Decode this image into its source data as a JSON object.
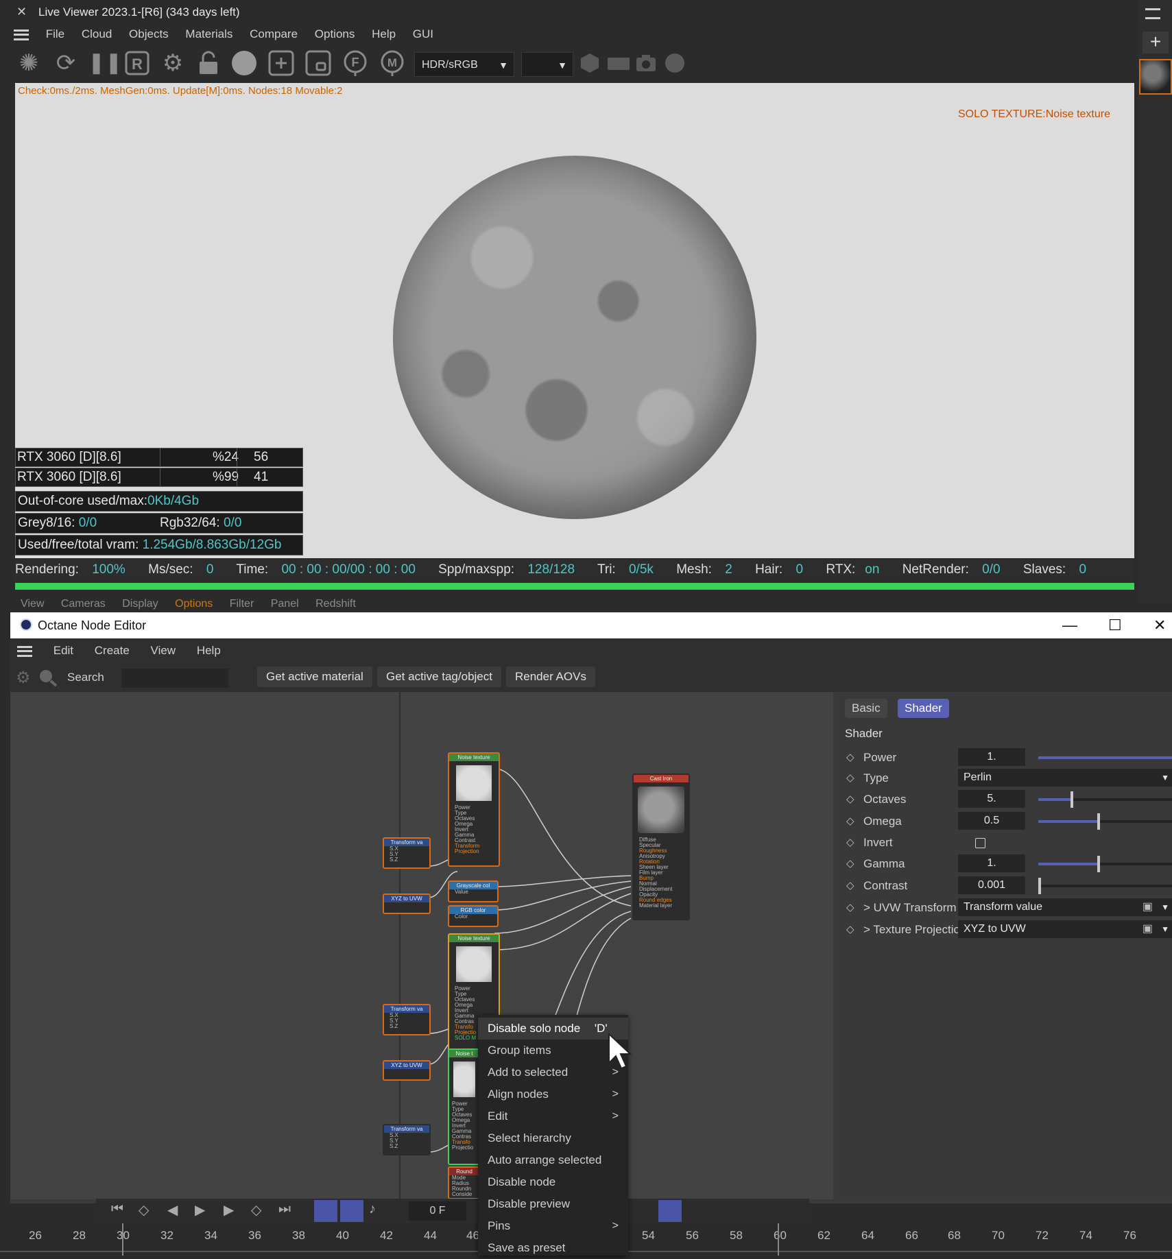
{
  "live_viewer": {
    "title": "Live Viewer 2023.1-[R6] (343 days left)",
    "close_glyph": "✕",
    "menu": [
      "File",
      "Cloud",
      "Objects",
      "Materials",
      "Compare",
      "Options",
      "Help",
      "GUI"
    ],
    "color_space": "HDR/sRGB",
    "second_select": "",
    "stats_line": "Check:0ms./2ms. MeshGen:0ms. Update[M]:0ms. Nodes:18 Movable:2",
    "solo_label": "SOLO TEXTURE:Noise texture",
    "devices": [
      {
        "name": "RTX 3060 [D][8.6]",
        "usage": "%24",
        "temp": "56"
      },
      {
        "name": "RTX 3060 [D][8.6]",
        "usage": "%99",
        "temp": "41"
      }
    ],
    "out_of_core": {
      "label": "Out-of-core used/max:",
      "value": "0Kb/4Gb"
    },
    "grey": {
      "label": "Grey8/16: ",
      "value": "0/0"
    },
    "rgb": {
      "label": "Rgb32/64: ",
      "value": "0/0"
    },
    "vram": {
      "label": "Used/free/total vram: ",
      "value": "1.254Gb/8.863Gb/12Gb"
    },
    "render_status": {
      "rendering_label": "Rendering: ",
      "rendering": "100%",
      "ms_label": "Ms/sec: ",
      "ms": "0",
      "time_label": "Time: ",
      "time": "00 : 00 : 00/00 : 00 : 00",
      "spp_label": "Spp/maxspp: ",
      "spp": "128/128",
      "tri_label": "Tri: ",
      "tri": "0/5k",
      "mesh_label": "Mesh: ",
      "mesh": "2",
      "hair_label": "Hair: ",
      "hair": "0",
      "rtx_label": "RTX:",
      "rtx": "on",
      "net_label": "NetRender: ",
      "net": "0/0",
      "slaves_label": "Slaves: ",
      "slaves": "0"
    },
    "progress": 1.0,
    "behind_menu": [
      "View",
      "Cameras",
      "Display",
      "Options",
      "Filter",
      "Panel",
      "Redshift"
    ]
  },
  "node_editor": {
    "title": "Octane Node Editor",
    "menu": [
      "Edit",
      "Create",
      "View",
      "Help"
    ],
    "search_label": "Search",
    "buttons": [
      "Get active material",
      "Get active tag/object",
      "Render AOVs"
    ],
    "tabs": [
      "Basic",
      "Shader"
    ],
    "section": "Shader",
    "params": [
      {
        "label": "Power",
        "value": "1.",
        "fill": 1.0
      },
      {
        "label": "Type",
        "value": "Perlin"
      },
      {
        "label": "Octaves",
        "value": "5.",
        "fill": 0.25
      },
      {
        "label": "Omega",
        "value": "0.5",
        "fill": 0.45
      },
      {
        "label": "Invert",
        "value": ""
      },
      {
        "label": "Gamma",
        "value": "1.",
        "fill": 0.45
      },
      {
        "label": "Contrast",
        "value": "0.001",
        "fill": 0.01
      },
      {
        "label": "UVW Transform",
        "value": "Transform value"
      },
      {
        "label": "Texture Projection",
        "value": "XYZ to UVW"
      }
    ],
    "nodes": {
      "noise1": "Noise texture",
      "cast_iron": "Cast Iron",
      "transform1": "Transform va",
      "xyz1": "XYZ to UVW",
      "grayscale": "Grayscale col",
      "grayscale_pin": "Value",
      "rgb": "RGB color",
      "rgb_pin": "Color",
      "noise2": "Noise texture",
      "transform2": "Transform va",
      "xyz2": "XYZ to UVW",
      "noise3": "Noise t",
      "transform3": "Transform va",
      "round": "Round",
      "solo_tag": "SOLO M",
      "noise_pins": [
        "Power",
        "Type",
        "Octaves",
        "Omega",
        "Invert",
        "Gamma",
        "Contrast",
        "Transform",
        "Projection"
      ],
      "noise_pins_short": [
        "Power",
        "Type",
        "Octaves",
        "Omega",
        "Invert",
        "Gamma",
        "Contras",
        "Transfo",
        "Projectio"
      ],
      "transform_pins": [
        "S.X",
        "S.Y",
        "S.Z"
      ],
      "material_pins": [
        "Diffuse",
        "Specular",
        "Roughness",
        "Anisotropy",
        "Rotation",
        "Sheen layer",
        "Film layer",
        "Bump",
        "Normal",
        "Displacement",
        "Opacity",
        "Round edges",
        "Material layer"
      ],
      "round_pins": [
        "Mode",
        "Radius",
        "Roundn",
        "Conside"
      ]
    }
  },
  "context_menu": {
    "items": [
      {
        "label": "Disable solo node",
        "shortcut": "'D'",
        "submenu": false,
        "highlight": true
      },
      {
        "label": "Group items",
        "submenu": false
      },
      {
        "label": "Add to selected",
        "submenu": true
      },
      {
        "label": "Align nodes",
        "submenu": true
      },
      {
        "label": "Edit",
        "submenu": true
      },
      {
        "label": "Select hierarchy",
        "submenu": false
      },
      {
        "label": "Auto arrange selected",
        "submenu": false
      },
      {
        "label": "Disable node",
        "submenu": false
      },
      {
        "label": "Disable preview",
        "submenu": false
      },
      {
        "label": "Pins",
        "submenu": true
      },
      {
        "label": "Save as preset",
        "submenu": false
      }
    ]
  },
  "timeline": {
    "frame": "0 F",
    "ticks": [
      "26",
      "28",
      "30",
      "32",
      "34",
      "36",
      "38",
      "40",
      "42",
      "44",
      "46",
      "54",
      "56",
      "58",
      "60",
      "62",
      "64",
      "66",
      "68",
      "70",
      "72",
      "74",
      "76"
    ]
  },
  "colors": {
    "accent": "#5860b5",
    "progress": "#3ad35a",
    "cyan_value": "#4fc6c8",
    "warning": "#c86400"
  }
}
